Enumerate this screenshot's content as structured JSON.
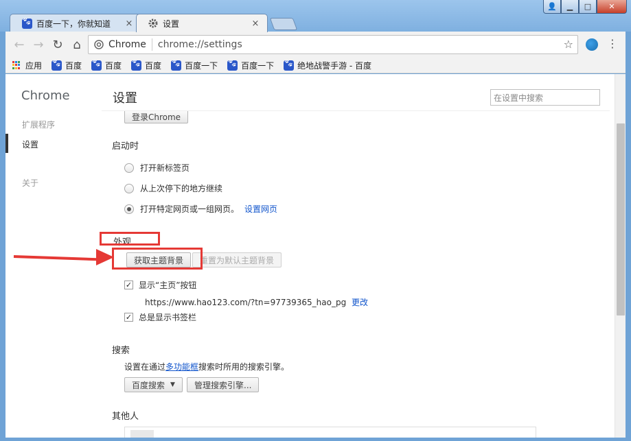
{
  "window": {
    "controls": {
      "user": "👤",
      "minimize": "▁",
      "maximize": "□",
      "close": "✕"
    }
  },
  "tabs": [
    {
      "title": "百度一下，你就知道",
      "icon": "baidu-paw-icon",
      "close": "×"
    },
    {
      "title": "设置",
      "icon": "gear-icon",
      "close": "×"
    }
  ],
  "toolbar": {
    "back": "←",
    "forward": "→",
    "reload": "↻",
    "home": "⌂",
    "omnibox_chip": "Chrome",
    "omnibox_url": "chrome://settings",
    "star": "☆",
    "menu": "⋮"
  },
  "bookmarks": [
    {
      "label": "应用",
      "icon": "apps-grid-icon"
    },
    {
      "label": "百度",
      "icon": "baidu-paw-icon"
    },
    {
      "label": "百度",
      "icon": "baidu-paw-icon"
    },
    {
      "label": "百度",
      "icon": "baidu-paw-icon"
    },
    {
      "label": "百度一下",
      "icon": "baidu-paw-icon"
    },
    {
      "label": "百度一下",
      "icon": "baidu-paw-icon"
    },
    {
      "label": "绝地战警手游 - 百度",
      "icon": "baidu-paw-icon"
    }
  ],
  "sidebar": {
    "brand": "Chrome",
    "items": [
      {
        "label": "扩展程序"
      },
      {
        "label": "设置"
      },
      {
        "label": "关于"
      }
    ]
  },
  "header": {
    "title": "设置",
    "search_placeholder": "在设置中搜索"
  },
  "signin": {
    "button": "登录Chrome"
  },
  "startup": {
    "title": "启动时",
    "options": [
      {
        "label": "打开新标签页",
        "checked": false
      },
      {
        "label": "从上次停下的地方继续",
        "checked": false
      },
      {
        "label": "打开特定网页或一组网页。",
        "checked": true,
        "link": "设置网页"
      }
    ]
  },
  "appearance": {
    "title": "外观",
    "get_theme": "获取主题背景",
    "reset_theme": "重置为默认主题背景",
    "show_home": "显示“主页”按钮",
    "home_url": "https://www.hao123.com/?tn=97739365_hao_pg",
    "change": "更改",
    "show_bookmarks": "总是显示书签栏"
  },
  "search": {
    "title": "搜索",
    "desc_prefix": "设置在通过",
    "desc_link": "多功能框",
    "desc_suffix": "搜索时所用的搜索引擎。",
    "engine": "百度搜索",
    "manage": "管理搜索引擎..."
  },
  "people": {
    "title": "其他人"
  },
  "colors": {
    "accent_red": "#e53935",
    "link_blue": "#1155cc"
  }
}
